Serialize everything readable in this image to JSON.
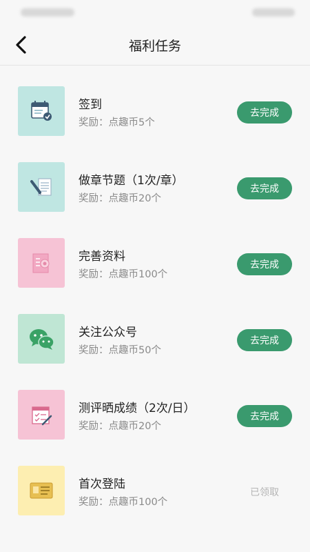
{
  "header": {
    "title": "福利任务"
  },
  "tasks": [
    {
      "title": "签到",
      "reward": "奖励：点趣币5个",
      "action": "去完成",
      "icon": "calendar-check-icon",
      "bg": "#bfe6e2"
    },
    {
      "title": "做章节题（1次/章）",
      "reward": "奖励：点趣币20个",
      "action": "去完成",
      "icon": "pen-document-icon",
      "bg": "#bfe6e2"
    },
    {
      "title": "完善资料",
      "reward": "奖励：点趣币100个",
      "action": "去完成",
      "icon": "profile-document-icon",
      "bg": "#f6c3d5"
    },
    {
      "title": "关注公众号",
      "reward": "奖励：点趣币50个",
      "action": "去完成",
      "icon": "wechat-icon",
      "bg": "#bfe6d4"
    },
    {
      "title": "测评晒成绩（2次/日）",
      "reward": "奖励：点趣币20个",
      "action": "去完成",
      "icon": "score-report-icon",
      "bg": "#f6c3d5"
    },
    {
      "title": "首次登陆",
      "reward": "奖励：点趣币100个",
      "action": "已领取",
      "icon": "id-card-icon",
      "bg": "#fdeeb1"
    }
  ],
  "colors": {
    "accent": "#3a9a6e",
    "done_text": "#b5b5b5"
  }
}
